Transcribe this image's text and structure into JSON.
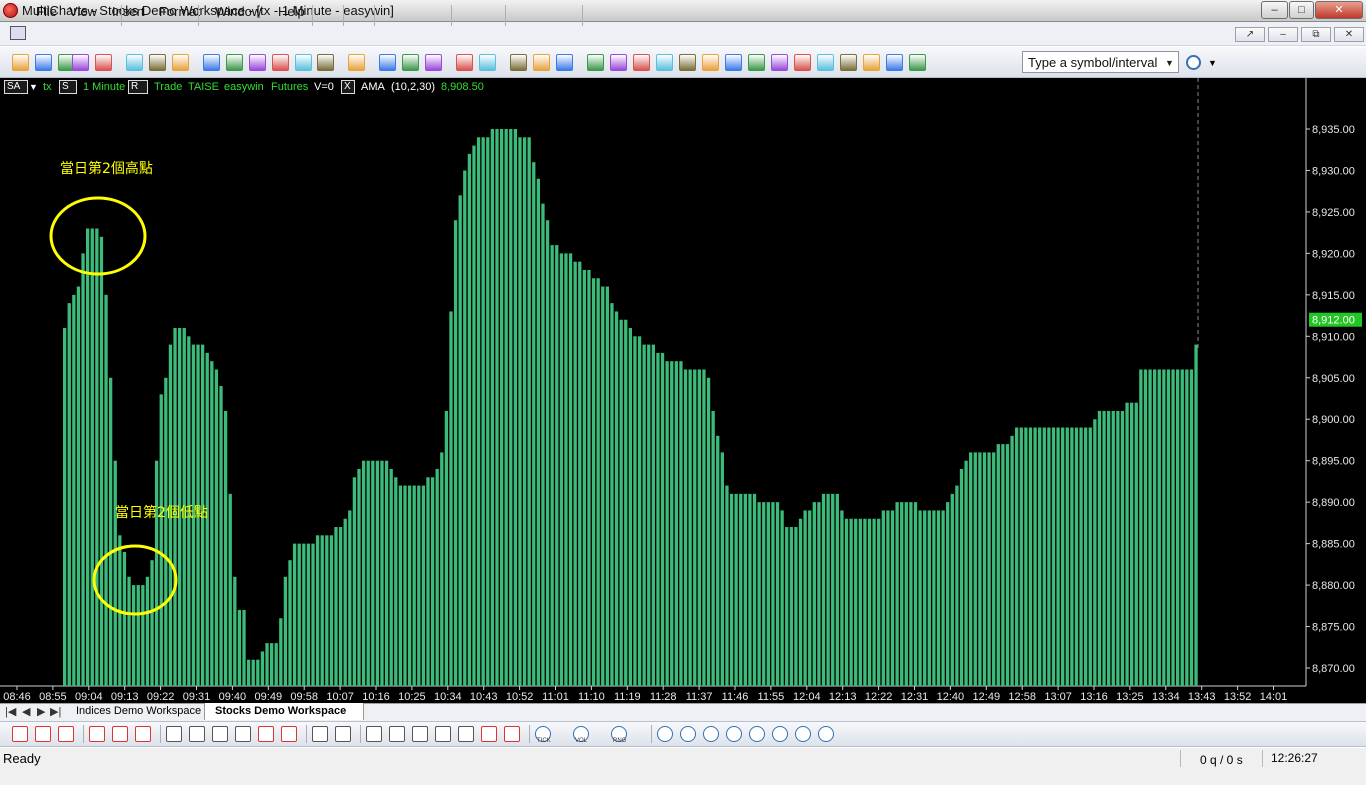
{
  "window": {
    "title": "MultiCharts - Stocks Demo Workspace - [tx - 1 Minute - easywin]"
  },
  "menu": [
    "File",
    "View",
    "Insert",
    "Format",
    "Window",
    "Help"
  ],
  "toolbar": {
    "symbol_placeholder": "Type a symbol/interval"
  },
  "status_line": {
    "sa_label": "SA",
    "symbol": "tx",
    "s_label": "S",
    "interval": "1 Minute",
    "r_label": "R",
    "mode": "Trade",
    "exchange": "TAISE",
    "datafeed": "easywin",
    "category": "Futures",
    "volume": "V=0",
    "x_label": "X",
    "indicator_name": "AMA",
    "indicator_params": "(10,2,30)",
    "indicator_value": "8,908.50"
  },
  "annotations": {
    "high_label": "當日第2個高點",
    "low_label": "當日第2個低點"
  },
  "colors": {
    "bar": "#3dbb7a",
    "background": "#000000",
    "annotation": "#ffff00",
    "price_tag": "#22c622",
    "status_green": "#33dd33"
  },
  "chart_data": {
    "type": "bar",
    "x_tick_labels": [
      "08:46",
      "08:55",
      "09:04",
      "09:13",
      "09:22",
      "09:31",
      "09:40",
      "09:49",
      "09:58",
      "10:07",
      "10:16",
      "10:25",
      "10:34",
      "10:43",
      "10:52",
      "11:01",
      "11:10",
      "11:19",
      "11:28",
      "11:37",
      "11:46",
      "11:55",
      "12:04",
      "12:13",
      "12:22",
      "12:31",
      "12:40",
      "12:49",
      "12:58",
      "13:07",
      "13:16",
      "13:25",
      "13:34",
      "13:43",
      "13:52",
      "14:01"
    ],
    "y_tick_labels": [
      "8,935.00",
      "8,930.00",
      "8,925.00",
      "8,920.00",
      "8,915.00",
      "8,910.00",
      "8,905.00",
      "8,900.00",
      "8,895.00",
      "8,890.00",
      "8,885.00",
      "8,880.00",
      "8,875.00",
      "8,870.00"
    ],
    "y_ticks": [
      8935,
      8930,
      8925,
      8920,
      8915,
      8910,
      8905,
      8900,
      8895,
      8890,
      8885,
      8880,
      8875,
      8870
    ],
    "ylim": [
      8867.1,
      8940.6
    ],
    "last_price_label": "8,912.00",
    "last_price": 8912,
    "grid": false,
    "values": [
      8911,
      8914,
      8915,
      8916,
      8920,
      8923,
      8923,
      8923,
      8922,
      8915,
      8905,
      8895,
      8886,
      8884,
      8881,
      8880,
      8880,
      8880,
      8881,
      8883,
      8895,
      8903,
      8905,
      8909,
      8911,
      8911,
      8911,
      8910,
      8909,
      8909,
      8909,
      8908,
      8907,
      8906,
      8904,
      8901,
      8891,
      8881,
      8877,
      8877,
      8871,
      8871,
      8871,
      8872,
      8873,
      8873,
      8873,
      8876,
      8881,
      8883,
      8885,
      8885,
      8885,
      8885,
      8885,
      8886,
      8886,
      8886,
      8886,
      8887,
      8887,
      8888,
      8889,
      8893,
      8894,
      8895,
      8895,
      8895,
      8895,
      8895,
      8895,
      8894,
      8893,
      8892,
      8892,
      8892,
      8892,
      8892,
      8892,
      8893,
      8893,
      8894,
      8896,
      8901,
      8913,
      8924,
      8927,
      8930,
      8932,
      8933,
      8934,
      8934,
      8934,
      8935,
      8935,
      8935,
      8935,
      8935,
      8935,
      8934,
      8934,
      8934,
      8931,
      8929,
      8926,
      8924,
      8921,
      8921,
      8920,
      8920,
      8920,
      8919,
      8919,
      8918,
      8918,
      8917,
      8917,
      8916,
      8916,
      8914,
      8913,
      8912,
      8912,
      8911,
      8910,
      8910,
      8909,
      8909,
      8909,
      8908,
      8908,
      8907,
      8907,
      8907,
      8907,
      8906,
      8906,
      8906,
      8906,
      8906,
      8905,
      8901,
      8898,
      8896,
      8892,
      8891,
      8891,
      8891,
      8891,
      8891,
      8891,
      8890,
      8890,
      8890,
      8890,
      8890,
      8889,
      8887,
      8887,
      8887,
      8888,
      8889,
      8889,
      8890,
      8890,
      8891,
      8891,
      8891,
      8891,
      8889,
      8888,
      8888,
      8888,
      8888,
      8888,
      8888,
      8888,
      8888,
      8889,
      8889,
      8889,
      8890,
      8890,
      8890,
      8890,
      8890,
      8889,
      8889,
      8889,
      8889,
      8889,
      8889,
      8890,
      8891,
      8892,
      8894,
      8895,
      8896,
      8896,
      8896,
      8896,
      8896,
      8896,
      8897,
      8897,
      8897,
      8898,
      8899,
      8899,
      8899,
      8899,
      8899,
      8899,
      8899,
      8899,
      8899,
      8899,
      8899,
      8899,
      8899,
      8899,
      8899,
      8899,
      8899,
      8900,
      8901,
      8901,
      8901,
      8901,
      8901,
      8901,
      8902,
      8902,
      8902,
      8906,
      8906,
      8906,
      8906,
      8906,
      8906,
      8906,
      8906,
      8906,
      8906,
      8906,
      8906,
      8909
    ]
  },
  "tabs": [
    "Indices Demo Workspace",
    "Stocks Demo Workspace"
  ],
  "drawing_toolbar": {
    "tick_label": "TICK",
    "vol_label": "VOL",
    "rng_label": "RNG"
  },
  "statusbar": {
    "ready": "Ready",
    "queue": "0 q / 0 s",
    "time": "12:26:27"
  }
}
